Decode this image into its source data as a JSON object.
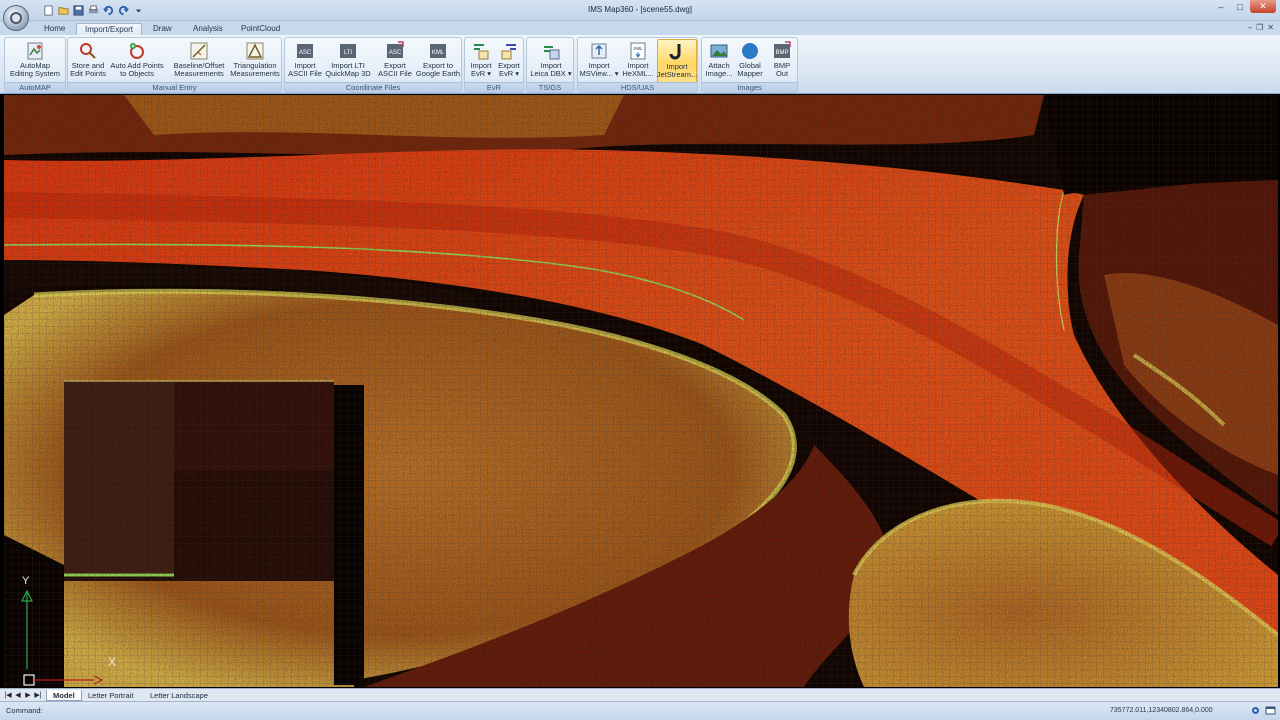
{
  "window": {
    "title": "IMS Map360 - [scene55.dwg]"
  },
  "quick_access": {
    "icons": [
      "new-icon",
      "open-icon",
      "save-icon",
      "print-icon",
      "undo-icon",
      "redo-icon",
      "customize-icon"
    ]
  },
  "tabs": [
    {
      "label": "Home"
    },
    {
      "label": "Import/Export",
      "active": true
    },
    {
      "label": "Draw"
    },
    {
      "label": "Analysis"
    },
    {
      "label": "PointCloud"
    }
  ],
  "ribbon": {
    "groups": [
      {
        "label": "AutoMAP",
        "buttons": [
          {
            "label": "AutoMap\nEditing System",
            "icon": "automap-icon"
          }
        ]
      },
      {
        "label": "Manual Entry",
        "buttons": [
          {
            "label": "Store and\nEdit Points",
            "icon": "store-points-icon"
          },
          {
            "label": "Auto Add Points\nto Objects",
            "icon": "add-points-icon"
          },
          {
            "label": "Baseline/Offset\nMeasurements",
            "icon": "baseline-icon"
          },
          {
            "label": "Triangulation\nMeasurements",
            "icon": "triangulation-icon"
          }
        ]
      },
      {
        "label": "Coordinate Files",
        "buttons": [
          {
            "label": "Import\nASCII File",
            "icon": "import-ascii-icon"
          },
          {
            "label": "Import LTI\nQuickMap 3D",
            "icon": "import-lti-icon"
          },
          {
            "label": "Export\nASCII File",
            "icon": "export-ascii-icon"
          },
          {
            "label": "Export to\nGoogle Earth",
            "icon": "export-kml-icon"
          }
        ]
      },
      {
        "label": "EvR",
        "buttons": [
          {
            "label": "Import\nEvR ▾",
            "icon": "import-evr-icon"
          },
          {
            "label": "Export\nEvR ▾",
            "icon": "export-evr-icon"
          }
        ]
      },
      {
        "label": "TS/GS",
        "buttons": [
          {
            "label": "Import\nLeica DBX ▾",
            "icon": "leica-icon"
          }
        ]
      },
      {
        "label": "HDS/UAS",
        "buttons": [
          {
            "label": "Import\nMSView... ▾",
            "icon": "msview-icon"
          },
          {
            "label": "Import\nHeXML...",
            "icon": "hexml-icon"
          },
          {
            "label": "Import\nJetStream...",
            "icon": "jetstream-icon",
            "hot": true
          }
        ]
      },
      {
        "label": "Images",
        "buttons": [
          {
            "label": "Attach\nImage...",
            "icon": "attach-image-icon"
          },
          {
            "label": "Global\nMapper",
            "icon": "global-mapper-icon"
          },
          {
            "label": "BMP\nOut",
            "icon": "bmp-out-icon"
          }
        ]
      }
    ]
  },
  "drawing": {
    "ucs_y": "Y",
    "ucs_x": "X"
  },
  "layout_tabs": [
    {
      "label": "Model",
      "active": true
    },
    {
      "label": "Letter Portrait"
    },
    {
      "label": "Letter Landscape"
    }
  ],
  "command": {
    "label": "Command:"
  },
  "status": {
    "coordinates": "735772.011,12340802.864,0.000"
  }
}
